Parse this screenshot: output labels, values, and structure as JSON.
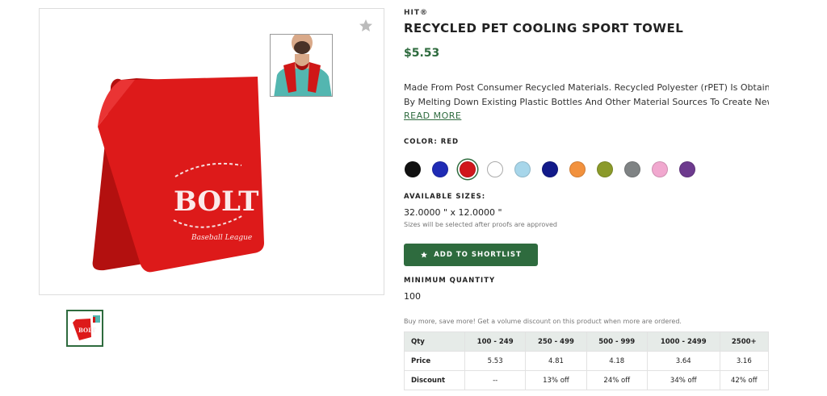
{
  "product": {
    "brand": "HIT®",
    "title": "RECYCLED PET COOLING SPORT TOWEL",
    "price": "$5.53",
    "description_line1": "Made From Post Consumer Recycled Materials. Recycled Polyester (rPET) Is Obtained",
    "description_line2": "By Melting Down Existing Plastic Bottles And Other Material Sources To Create New…",
    "read_more": "READ MORE"
  },
  "image": {
    "print_text": "BOLT",
    "print_subtext": "Baseball League"
  },
  "color": {
    "label": "COLOR: RED",
    "swatches": [
      {
        "name": "black",
        "hex": "#111111"
      },
      {
        "name": "royal-blue",
        "hex": "#1f2bb5"
      },
      {
        "name": "red",
        "hex": "#d1161c",
        "selected": true
      },
      {
        "name": "white",
        "hex": "#ffffff"
      },
      {
        "name": "light-blue",
        "hex": "#a7d6ea"
      },
      {
        "name": "navy",
        "hex": "#121a8a"
      },
      {
        "name": "orange",
        "hex": "#f2913d"
      },
      {
        "name": "olive",
        "hex": "#8b9a2a"
      },
      {
        "name": "gray",
        "hex": "#7f8384"
      },
      {
        "name": "pink",
        "hex": "#f1a8cf"
      },
      {
        "name": "purple",
        "hex": "#6d3a8e"
      }
    ]
  },
  "sizes": {
    "label": "AVAILABLE SIZES:",
    "value": "32.0000 \" x 12.0000 \"",
    "note": "Sizes will be selected after proofs are approved"
  },
  "shortlist_button": "ADD TO SHORTLIST",
  "min_qty": {
    "label": "MINIMUM QUANTITY",
    "value": "100"
  },
  "promo": "Buy more, save more! Get a volume discount on this product when more are ordered.",
  "pricing_table": {
    "headers": [
      "Qty",
      "100 - 249",
      "250 - 499",
      "500 - 999",
      "1000 - 2499",
      "2500+"
    ],
    "rows": [
      [
        "Price",
        "5.53",
        "4.81",
        "4.18",
        "3.64",
        "3.16"
      ],
      [
        "Discount",
        "--",
        "13% off",
        "24% off",
        "34% off",
        "42% off"
      ]
    ]
  },
  "colors": {
    "accent": "#2e6b3e",
    "towel": "#dd1a1a"
  }
}
